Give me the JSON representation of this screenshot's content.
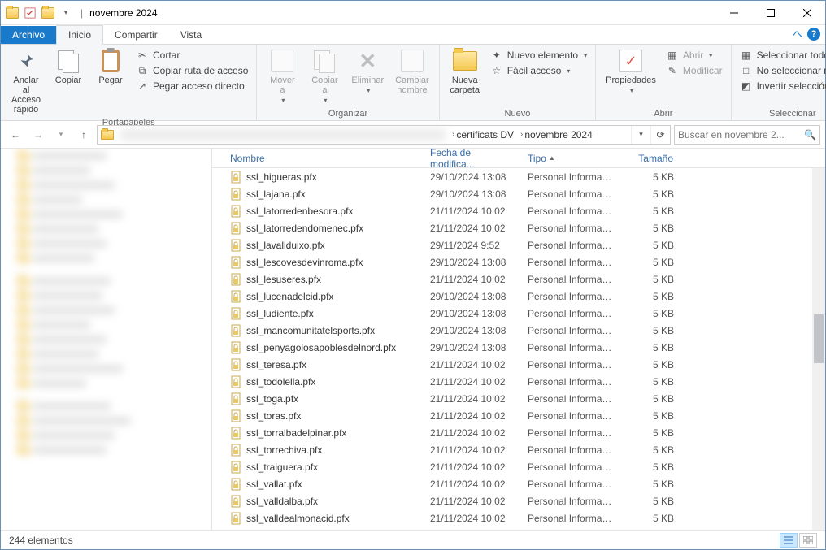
{
  "window": {
    "title": "novembre 2024",
    "title_separator": "|"
  },
  "tabs": {
    "file": "Archivo",
    "home": "Inicio",
    "share": "Compartir",
    "view": "Vista"
  },
  "ribbon": {
    "clipboard": {
      "label": "Portapapeles",
      "pin": "Anclar al\nAcceso rápido",
      "copy": "Copiar",
      "paste": "Pegar",
      "cut": "Cortar",
      "copy_path": "Copiar ruta de acceso",
      "paste_shortcut": "Pegar acceso directo"
    },
    "organize": {
      "label": "Organizar",
      "move": "Mover\na",
      "copy_to": "Copiar\na",
      "delete": "Eliminar",
      "rename": "Cambiar\nnombre"
    },
    "new": {
      "label": "Nuevo",
      "new_folder": "Nueva\ncarpeta",
      "new_item": "Nuevo elemento",
      "easy_access": "Fácil acceso"
    },
    "open": {
      "label": "Abrir",
      "properties": "Propiedades",
      "open": "Abrir",
      "edit": "Modificar"
    },
    "select": {
      "label": "Seleccionar",
      "select_all": "Seleccionar todo",
      "select_none": "No seleccionar nada",
      "invert": "Invertir selección"
    }
  },
  "breadcrumb": {
    "parts": [
      "certificats DV",
      "novembre 2024"
    ]
  },
  "search": {
    "placeholder": "Buscar en novembre 2..."
  },
  "columns": {
    "name": "Nombre",
    "date": "Fecha de modifica...",
    "type": "Tipo",
    "size": "Tamaño"
  },
  "type_label": "Personal Informati...",
  "files": [
    {
      "name": "ssl_higueras.pfx",
      "date": "29/10/2024 13:08",
      "size": "5 KB"
    },
    {
      "name": "ssl_lajana.pfx",
      "date": "29/10/2024 13:08",
      "size": "5 KB"
    },
    {
      "name": "ssl_latorredenbesora.pfx",
      "date": "21/11/2024 10:02",
      "size": "5 KB"
    },
    {
      "name": "ssl_latorredendomenec.pfx",
      "date": "21/11/2024 10:02",
      "size": "5 KB"
    },
    {
      "name": "ssl_lavallduixo.pfx",
      "date": "29/11/2024 9:52",
      "size": "5 KB"
    },
    {
      "name": "ssl_lescovesdevinroma.pfx",
      "date": "29/10/2024 13:08",
      "size": "5 KB"
    },
    {
      "name": "ssl_lesuseres.pfx",
      "date": "21/11/2024 10:02",
      "size": "5 KB"
    },
    {
      "name": "ssl_lucenadelcid.pfx",
      "date": "29/10/2024 13:08",
      "size": "5 KB"
    },
    {
      "name": "ssl_ludiente.pfx",
      "date": "29/10/2024 13:08",
      "size": "5 KB"
    },
    {
      "name": "ssl_mancomunitatelsports.pfx",
      "date": "29/10/2024 13:08",
      "size": "5 KB"
    },
    {
      "name": "ssl_penyagolosapoblesdelnord.pfx",
      "date": "29/10/2024 13:08",
      "size": "5 KB"
    },
    {
      "name": "ssl_teresa.pfx",
      "date": "21/11/2024 10:02",
      "size": "5 KB"
    },
    {
      "name": "ssl_todolella.pfx",
      "date": "21/11/2024 10:02",
      "size": "5 KB"
    },
    {
      "name": "ssl_toga.pfx",
      "date": "21/11/2024 10:02",
      "size": "5 KB"
    },
    {
      "name": "ssl_toras.pfx",
      "date": "21/11/2024 10:02",
      "size": "5 KB"
    },
    {
      "name": "ssl_torralbadelpinar.pfx",
      "date": "21/11/2024 10:02",
      "size": "5 KB"
    },
    {
      "name": "ssl_torrechiva.pfx",
      "date": "21/11/2024 10:02",
      "size": "5 KB"
    },
    {
      "name": "ssl_traiguera.pfx",
      "date": "21/11/2024 10:02",
      "size": "5 KB"
    },
    {
      "name": "ssl_vallat.pfx",
      "date": "21/11/2024 10:02",
      "size": "5 KB"
    },
    {
      "name": "ssl_valldalba.pfx",
      "date": "21/11/2024 10:02",
      "size": "5 KB"
    },
    {
      "name": "ssl_valldealmonacid.pfx",
      "date": "21/11/2024 10:02",
      "size": "5 KB"
    }
  ],
  "status": {
    "count": "244 elementos"
  }
}
